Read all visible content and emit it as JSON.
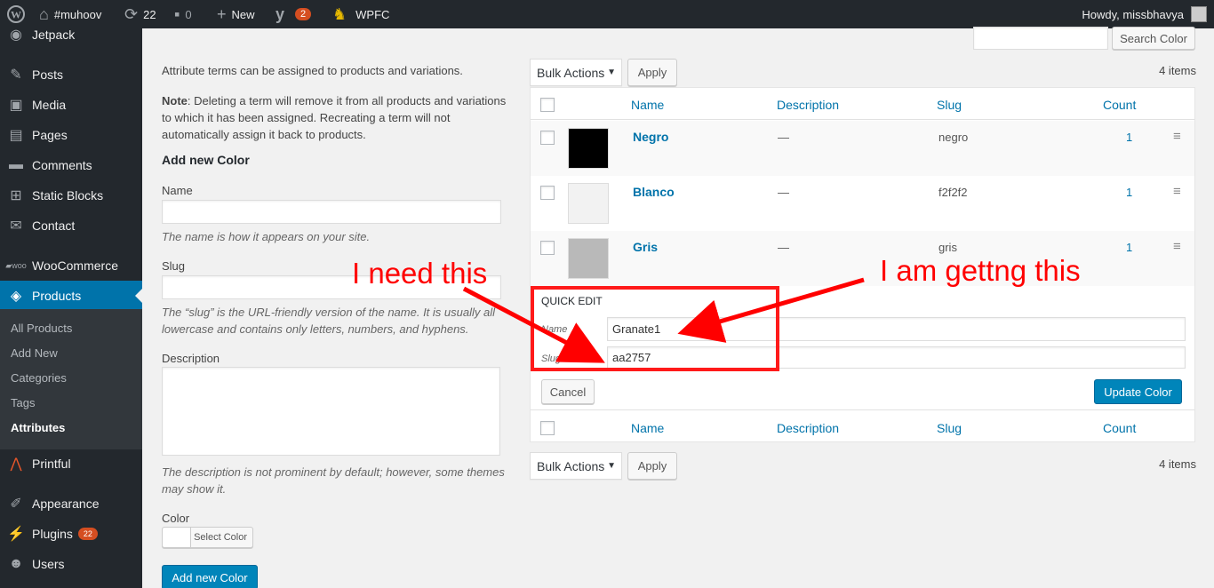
{
  "adminbar": {
    "site_name": "#muhoov",
    "updates_count": "22",
    "comments_count": "0",
    "new_label": "New",
    "yoast_badge": "2",
    "wpfc_label": "WPFC",
    "howdy": "Howdy, missbhavya"
  },
  "sidebar": {
    "items": [
      {
        "label": "Jetpack",
        "icon": "jetpack-icon"
      },
      {
        "label": "Posts",
        "icon": "pin-icon"
      },
      {
        "label": "Media",
        "icon": "media-icon"
      },
      {
        "label": "Pages",
        "icon": "pages-icon"
      },
      {
        "label": "Comments",
        "icon": "comment-icon"
      },
      {
        "label": "Static Blocks",
        "icon": "grid-icon"
      },
      {
        "label": "Contact",
        "icon": "mail-icon"
      },
      {
        "label": "WooCommerce",
        "icon": "woo-icon"
      },
      {
        "label": "Products",
        "icon": "products-icon"
      },
      {
        "label": "Printful",
        "icon": "printful-icon"
      },
      {
        "label": "Appearance",
        "icon": "brush-icon"
      },
      {
        "label": "Plugins",
        "icon": "plugin-icon",
        "badge": "22"
      },
      {
        "label": "Users",
        "icon": "user-icon"
      }
    ],
    "submenu": [
      "All Products",
      "Add New",
      "Categories",
      "Tags",
      "Attributes"
    ]
  },
  "search": {
    "button": "Search Color"
  },
  "form": {
    "intro": "Attribute terms can be assigned to products and variations.",
    "note_label": "Note",
    "note_text": ": Deleting a term will remove it from all products and variations to which it has been assigned. Recreating a term will not automatically assign it back to products.",
    "heading": "Add new Color",
    "name_label": "Name",
    "name_help": "The name is how it appears on your site.",
    "slug_label": "Slug",
    "slug_help": "The “slug” is the URL-friendly version of the name. It is usually all lowercase and contains only letters, numbers, and hyphens.",
    "desc_label": "Description",
    "desc_help": "The description is not prominent by default; however, some themes may show it.",
    "color_label": "Color",
    "select_color": "Select Color",
    "submit": "Add new Color"
  },
  "list": {
    "bulk_actions": "Bulk Actions",
    "apply": "Apply",
    "items_count": "4 items",
    "columns": {
      "name": "Name",
      "description": "Description",
      "slug": "Slug",
      "count": "Count"
    },
    "rows": [
      {
        "name": "Negro",
        "description": "—",
        "slug": "negro",
        "count": "1",
        "color": "#000000"
      },
      {
        "name": "Blanco",
        "description": "—",
        "slug": "f2f2f2",
        "count": "1",
        "color": "#f2f2f2"
      },
      {
        "name": "Gris",
        "description": "—",
        "slug": "gris",
        "count": "1",
        "color": "#b9b9b9"
      }
    ]
  },
  "quick_edit": {
    "title": "QUICK EDIT",
    "name_label": "Name",
    "name_value": "Granate1",
    "slug_label": "Slug",
    "slug_value": "aa2757",
    "cancel": "Cancel",
    "update": "Update Color"
  },
  "annotations": {
    "left": "I need this",
    "right": "I am gettng this"
  },
  "colors": {
    "accent": "#0073aa",
    "primary_button": "#0085ba",
    "admin_dark": "#23282d",
    "annotation": "#ff0000"
  }
}
